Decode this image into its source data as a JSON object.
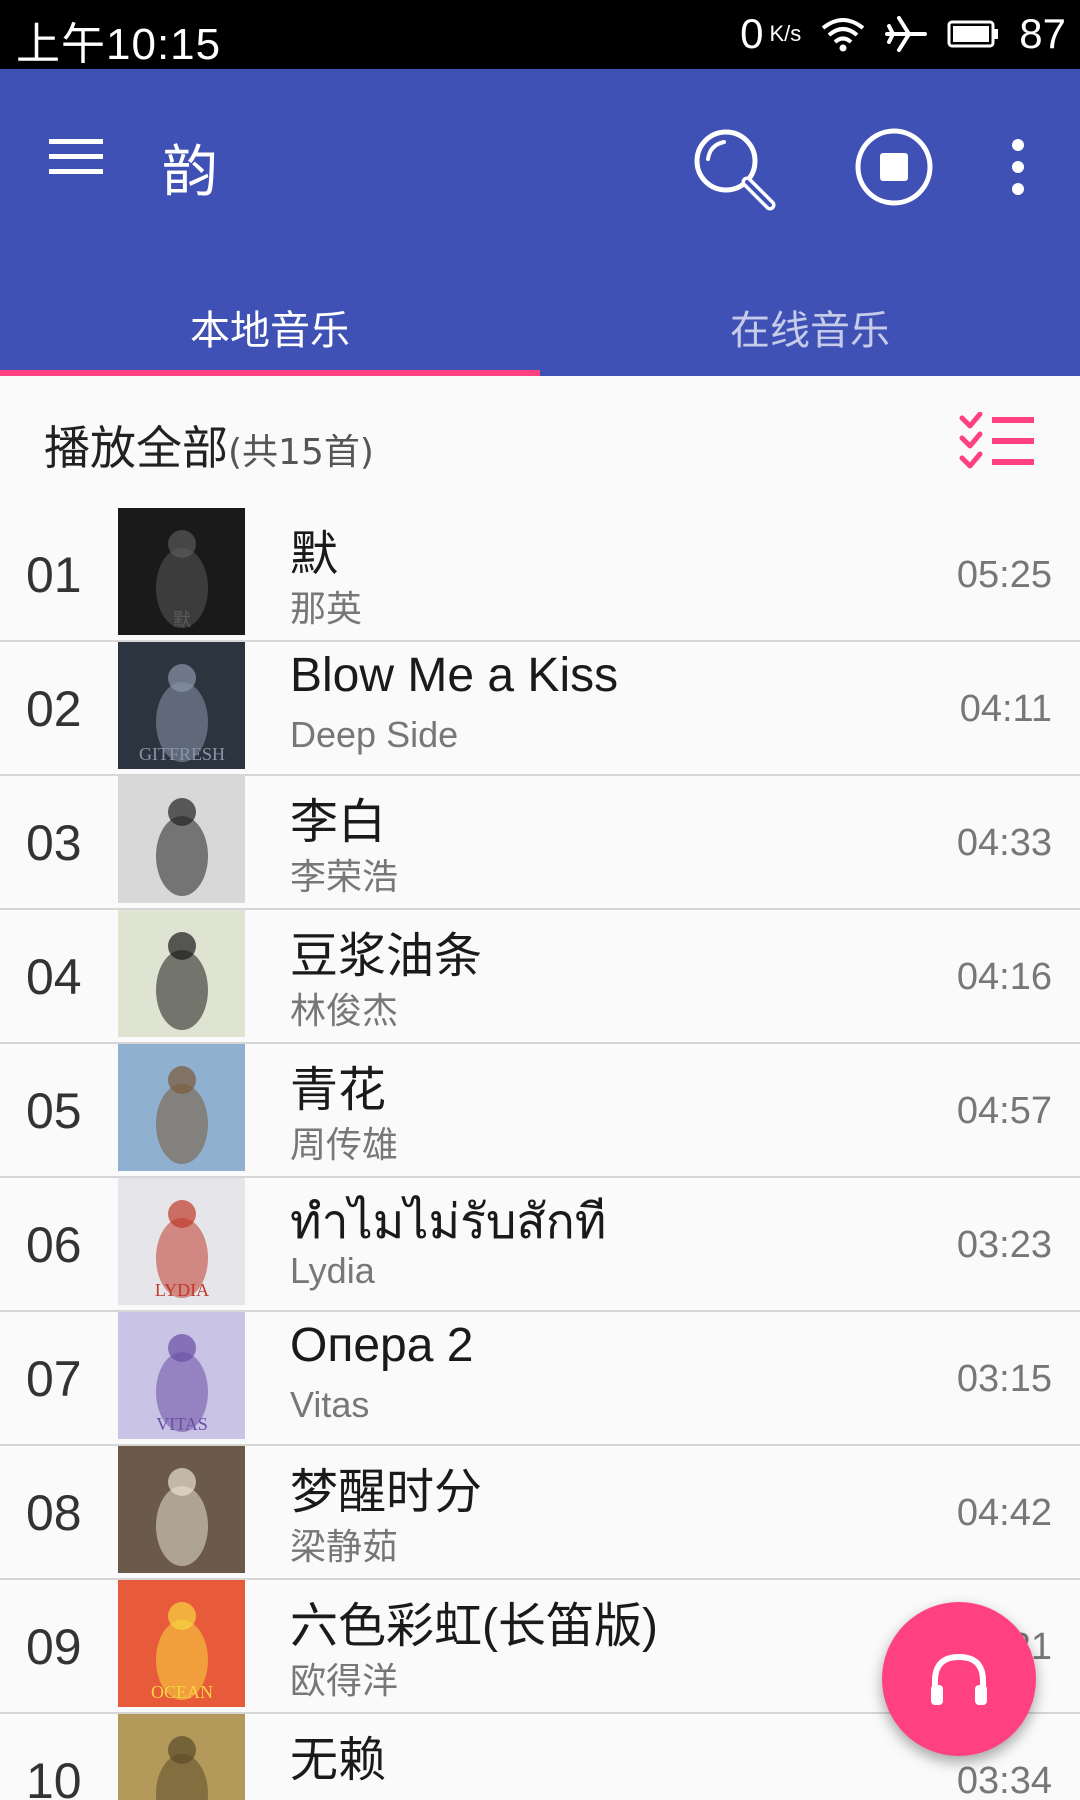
{
  "status_bar": {
    "time": "上午10:15",
    "net_speed": "0",
    "net_unit": "K/s",
    "battery": "87"
  },
  "app_bar": {
    "title": "韵",
    "tabs": [
      {
        "label": "本地音乐",
        "active": true
      },
      {
        "label": "在线音乐",
        "active": false
      }
    ],
    "accent_color": "#3f51b5",
    "indicator_color": "#ff4081"
  },
  "play_all": {
    "label": "播放全部",
    "count": "(共15首)"
  },
  "songs": [
    {
      "index": "01",
      "title": "默",
      "artist": "那英",
      "duration": "05:25"
    },
    {
      "index": "02",
      "title": "Blow Me a Kiss",
      "artist": "Deep Side",
      "duration": "04:11"
    },
    {
      "index": "03",
      "title": "李白",
      "artist": "李荣浩",
      "duration": "04:33"
    },
    {
      "index": "04",
      "title": "豆浆油条",
      "artist": "林俊杰",
      "duration": "04:16"
    },
    {
      "index": "05",
      "title": "青花",
      "artist": "周传雄",
      "duration": "04:57"
    },
    {
      "index": "06",
      "title": "ทำไมไม่รับสักที",
      "artist": "Lydia",
      "duration": "03:23"
    },
    {
      "index": "07",
      "title": "Опера 2",
      "artist": "Vitas",
      "duration": "03:15"
    },
    {
      "index": "08",
      "title": "梦醒时分",
      "artist": "梁静茹",
      "duration": "04:42"
    },
    {
      "index": "09",
      "title": "六色彩虹(长笛版)",
      "artist": "欧得洋",
      "duration": "04:21"
    },
    {
      "index": "10",
      "title": "无赖",
      "artist": "",
      "duration": "03:34"
    }
  ],
  "covers": [
    {
      "bg": "#1a1a1a",
      "fg": "#5a5a5a",
      "text": "默"
    },
    {
      "bg": "#2c3440",
      "fg": "#8a95a8",
      "text": "GITFRESH"
    },
    {
      "bg": "#d8d8d8",
      "fg": "#222222",
      "text": ""
    },
    {
      "bg": "#dfe4d2",
      "fg": "#1a1a1a",
      "text": ""
    },
    {
      "bg": "#8fb1cf",
      "fg": "#7a5a3a",
      "text": ""
    },
    {
      "bg": "#e6e6ea",
      "fg": "#c0392b",
      "text": "LYDIA"
    },
    {
      "bg": "#c9c3e6",
      "fg": "#6a4fa3",
      "text": "VITAS"
    },
    {
      "bg": "#6b5a4a",
      "fg": "#e8e0d0",
      "text": ""
    },
    {
      "bg": "#e85b3a",
      "fg": "#f7d640",
      "text": "OCEAN"
    },
    {
      "bg": "#b39a5a",
      "fg": "#5a4a2a",
      "text": ""
    }
  ],
  "fab": {
    "icon": "headphones-icon",
    "color": "#ff4081"
  }
}
